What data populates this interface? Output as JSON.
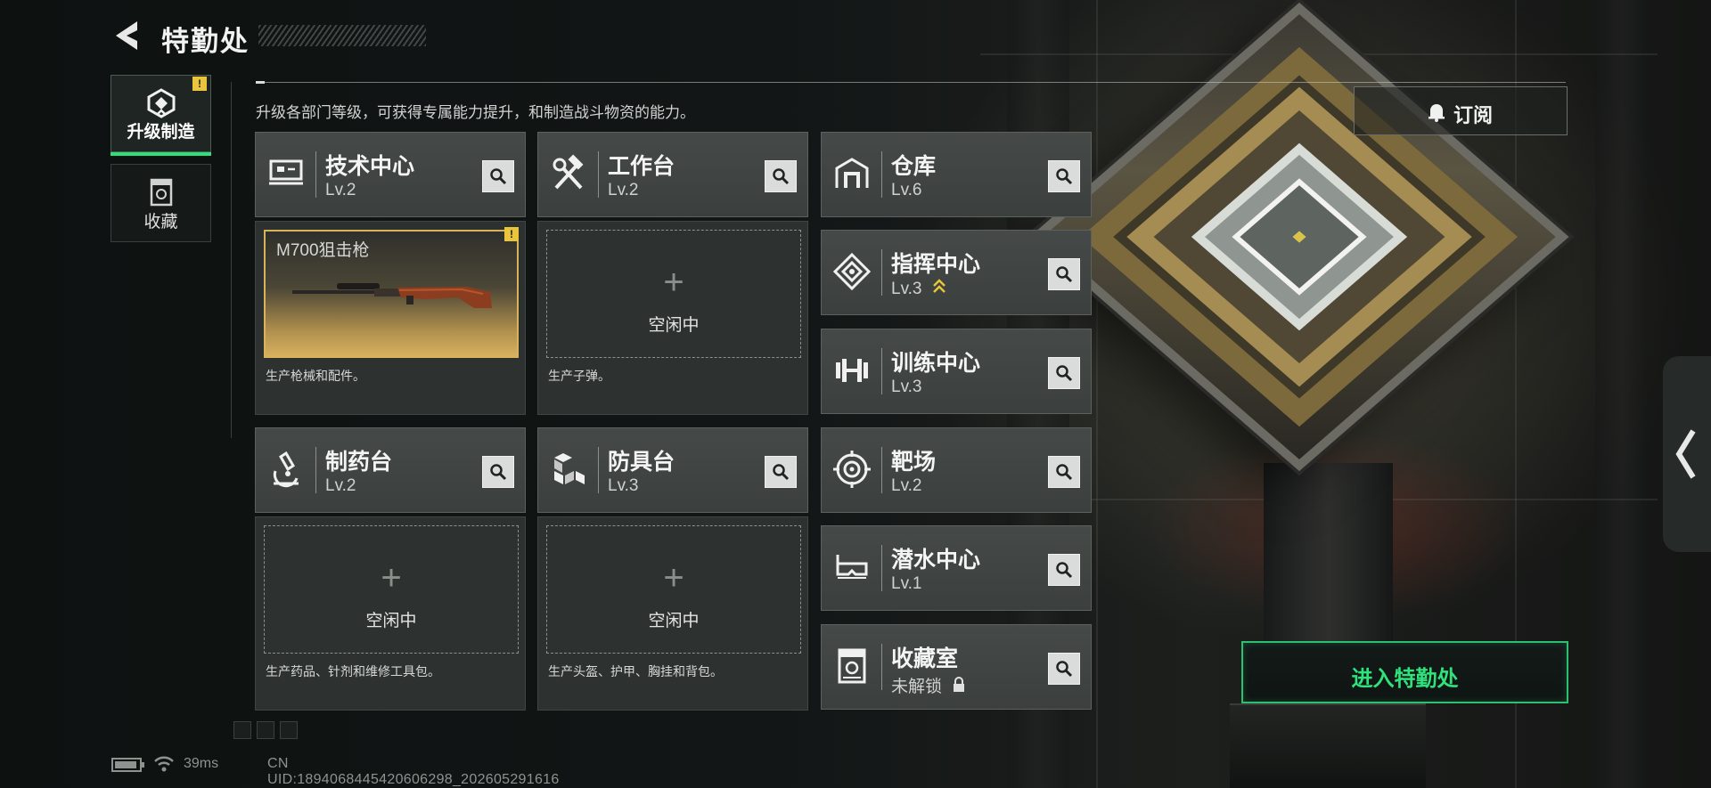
{
  "header": {
    "title": "特勤处",
    "subtitle": "升级各部门等级，可获得专属能力提升，和制造战斗物资的能力。"
  },
  "nav": {
    "items": [
      {
        "label": "升级制造",
        "icon": "upgrade-build-icon",
        "active": true,
        "alert": "!"
      },
      {
        "label": "收藏",
        "icon": "collection-icon",
        "active": false
      }
    ]
  },
  "departments": {
    "tech_center": {
      "name": "技术中心",
      "level": "Lv.2",
      "icon": "tech-center-icon"
    },
    "workbench": {
      "name": "工作台",
      "level": "Lv.2",
      "icon": "hammer-wrench-icon"
    },
    "warehouse": {
      "name": "仓库",
      "level": "Lv.6",
      "icon": "warehouse-icon"
    },
    "command_center": {
      "name": "指挥中心",
      "level": "Lv.3",
      "icon": "command-center-icon",
      "upgradable": true
    },
    "training_center": {
      "name": "训练中心",
      "level": "Lv.3",
      "icon": "dumbbell-icon"
    },
    "shooting_range": {
      "name": "靶场",
      "level": "Lv.2",
      "icon": "target-icon"
    },
    "pharmacy": {
      "name": "制药台",
      "level": "Lv.2",
      "icon": "microscope-icon"
    },
    "armor_bench": {
      "name": "防具台",
      "level": "Lv.3",
      "icon": "cubes-icon"
    },
    "diving_center": {
      "name": "潜水中心",
      "level": "Lv.1",
      "icon": "diving-mask-icon"
    },
    "collection_room": {
      "name": "收藏室",
      "level": "未解锁",
      "icon": "collection-room-icon",
      "locked": true
    }
  },
  "production": {
    "tech_center": {
      "item": "M700狙击枪",
      "desc": "生产枪械和配件。",
      "alert": "!"
    },
    "workbench": {
      "status": "空闲中",
      "desc": "生产子弹。"
    },
    "pharmacy": {
      "status": "空闲中",
      "desc": "生产药品、针剂和维修工具包。"
    },
    "armor_bench": {
      "status": "空闲中",
      "desc": "生产头盔、护甲、胸挂和背包。"
    }
  },
  "actions": {
    "subscribe": "订阅",
    "enter": "进入特勤处"
  },
  "status_bar": {
    "ping": "39ms",
    "uid": "CN UID:1894068445420606298_202605291616"
  },
  "colors": {
    "accent": "#2fe27c",
    "alert": "#e8c53a",
    "gold": "#d9b25a"
  }
}
